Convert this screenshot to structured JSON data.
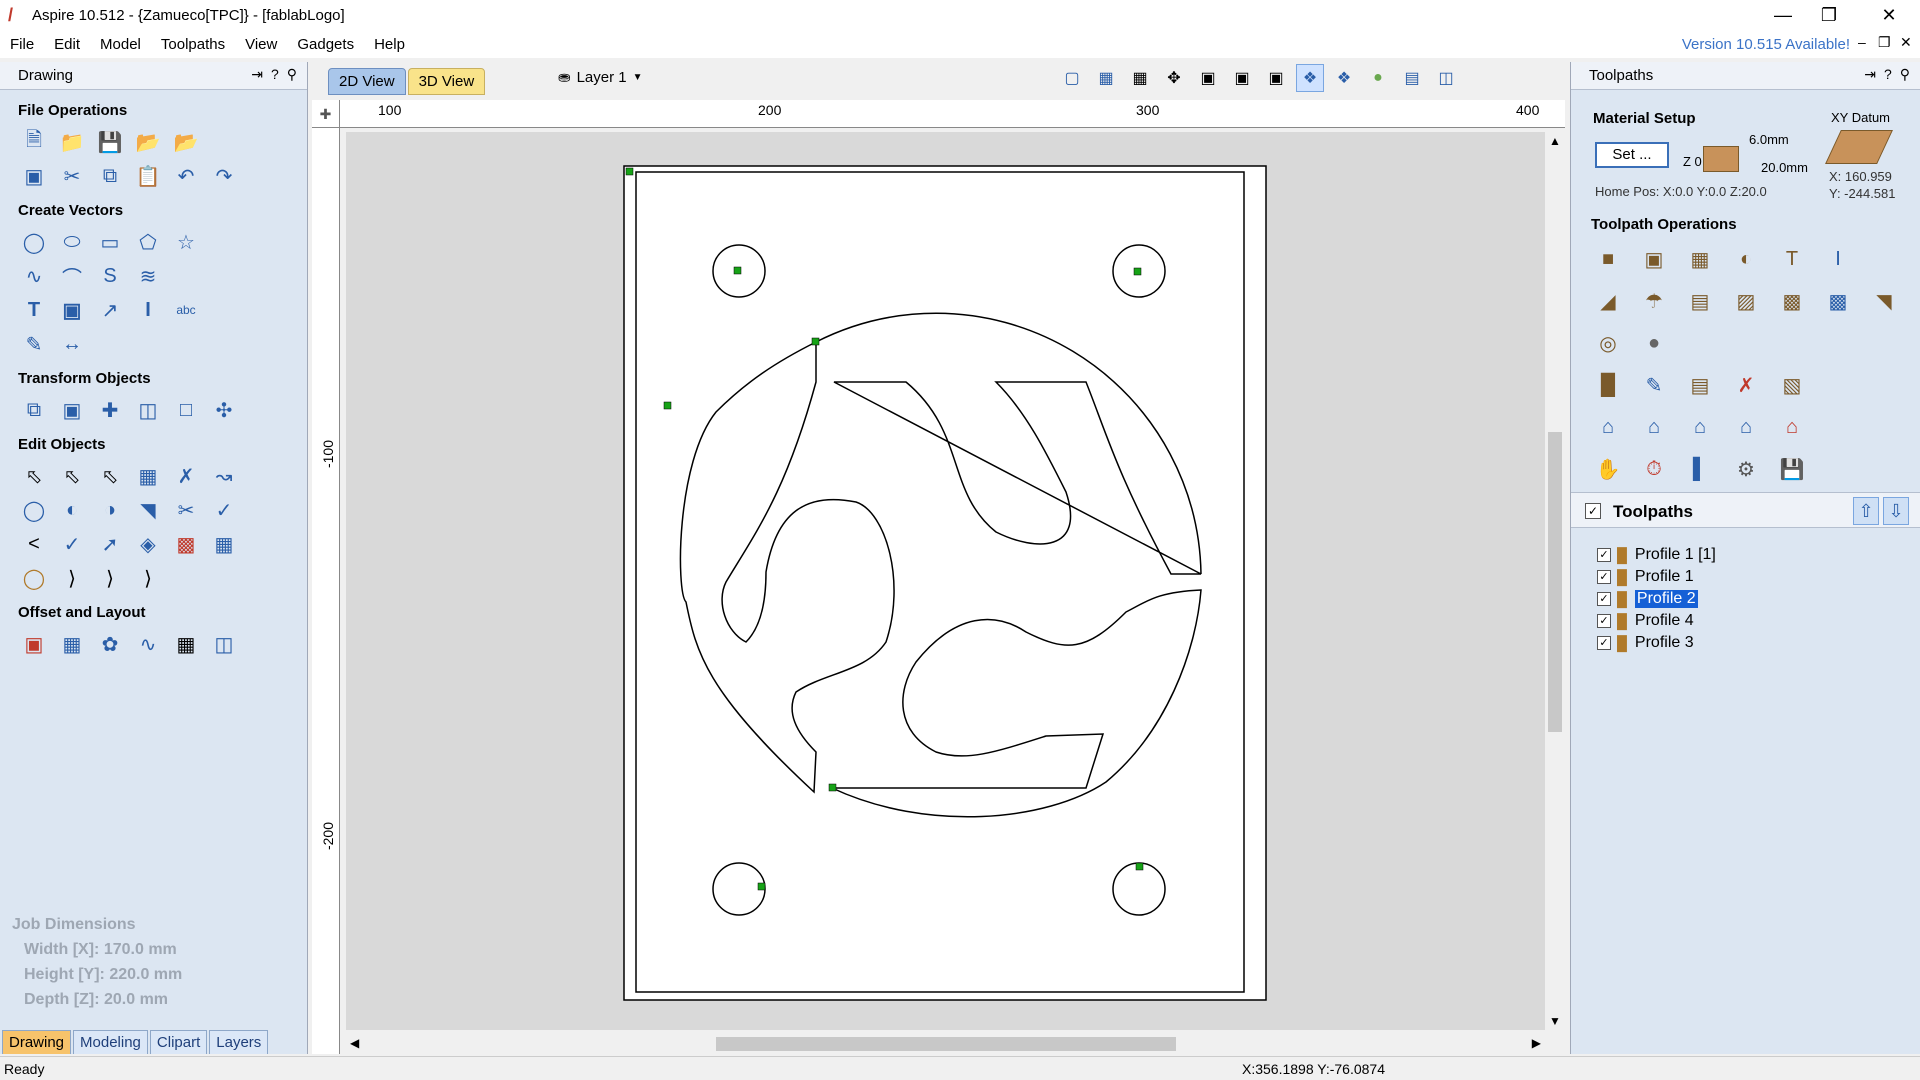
{
  "window": {
    "title": "Aspire 10.512 - {Zamueco[TPC]} - [fablabLogo]"
  },
  "menu": [
    "File",
    "Edit",
    "Model",
    "Toolpaths",
    "View",
    "Gadgets",
    "Help"
  ],
  "update_notice": "Version 10.515 Available!",
  "left_panel": {
    "title": "Drawing",
    "sections": {
      "file_ops": "File Operations",
      "create_vectors": "Create Vectors",
      "transform": "Transform Objects",
      "edit": "Edit Objects",
      "offset": "Offset and Layout"
    },
    "job_dimensions": {
      "title": "Job Dimensions",
      "width": "Width  [X]: 170.0 mm",
      "height": "Height [Y]: 220.0 mm",
      "depth": "Depth  [Z]: 20.0 mm"
    },
    "tabs": [
      "Drawing",
      "Modeling",
      "Clipart",
      "Layers"
    ]
  },
  "view": {
    "tabs": [
      "2D View",
      "3D View"
    ],
    "layer": "Layer 1",
    "ruler_top": [
      "100",
      "200",
      "300",
      "400"
    ],
    "ruler_left": [
      "-100",
      "-200"
    ]
  },
  "right_panel": {
    "title": "Toolpaths",
    "material_setup": "Material Setup",
    "set_button": "Set ...",
    "z0": "Z 0",
    "thickness_top": "6.0mm",
    "thickness_total": "20.0mm",
    "home_pos": "Home Pos:  X:0.0 Y:0.0 Z:20.0",
    "xy_datum": "XY Datum",
    "xy_x": "X: 160.959",
    "xy_y": "Y: -244.581",
    "toolpath_operations": "Toolpath Operations",
    "list_title": "Toolpaths",
    "toolpaths": [
      {
        "name": "Profile 1 [1]",
        "selected": false
      },
      {
        "name": "Profile 1",
        "selected": false
      },
      {
        "name": "Profile 2",
        "selected": true
      },
      {
        "name": "Profile 4",
        "selected": false
      },
      {
        "name": "Profile 3",
        "selected": false
      }
    ]
  },
  "status": {
    "left": "Ready",
    "coords": "X:356.1898 Y:-76.0874"
  }
}
